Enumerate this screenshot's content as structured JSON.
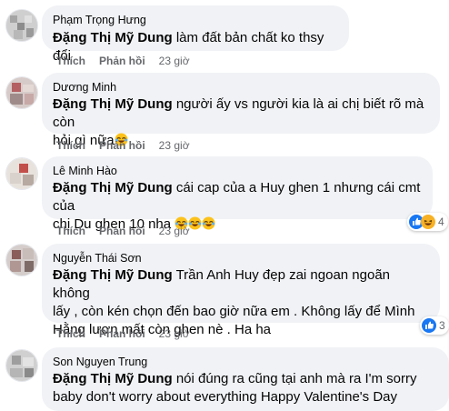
{
  "comments": [
    {
      "author": "Phạm Trọng Hưng",
      "mention": "Đặng Thị Mỹ Dung",
      "text": "làm đất bản chất ko thsy đổi",
      "like_label": "Thích",
      "reply_label": "Phản hồi",
      "time": "23 giờ"
    },
    {
      "author": "Dương Minh",
      "mention": "Đặng Thị Mỹ Dung",
      "text_line1": "người ấy vs người kia là ai chị biết rõ mà còn",
      "text_line2": "hỏi gì nữa",
      "like_label": "Thích",
      "reply_label": "Phản hồi",
      "time": "23 giờ"
    },
    {
      "author": "Lê Minh Hào",
      "mention": "Đặng Thị Mỹ Dung",
      "text_line1": "cái cap của a Huy ghen 1 nhưng cái cmt của",
      "text_line2": "chị Du ghen 10 nha",
      "like_label": "Thích",
      "reply_label": "Phản hồi",
      "time": "23 giờ",
      "reaction_count": "4"
    },
    {
      "author": "Nguyễn Thái Sơn",
      "mention": "Đặng Thị Mỹ Dung",
      "text_line1": "Trần Anh Huy đẹp zai ngoan ngoãn không",
      "text_line2": "lấy , còn kén chọn đến bao giờ nữa em . Không lấy để Mình",
      "text_line3": "Hằng lượn mất còn ghen nè . Ha ha",
      "like_label": "Thích",
      "reply_label": "Phản hồi",
      "time": "23 giờ",
      "reaction_count": "3"
    },
    {
      "author": "Son Nguyen Trung",
      "mention": "Đặng Thị Mỹ Dung",
      "text_line1": "nói đúng ra cũng tại anh mà ra I'm sorry",
      "text_line2": "baby don't worry about everything Happy Valentine's Day"
    }
  ],
  "colors": {
    "bubble": "#f0f2f5",
    "secondary_text": "#65676b",
    "like_blue": "#1877f2",
    "haha_yellow": "#f7b125"
  }
}
